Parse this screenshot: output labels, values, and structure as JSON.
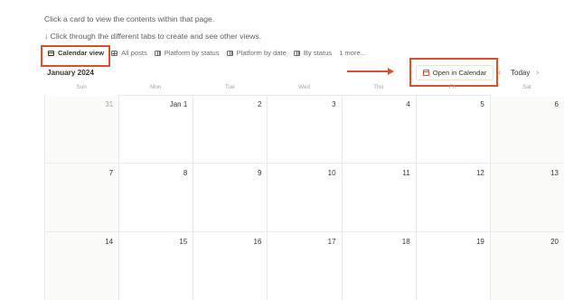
{
  "intro": {
    "line1": "Click a card to view the contents within that page.",
    "line2": "↓ Click through the different tabs to create and see other views."
  },
  "tabs": [
    {
      "label": "Calendar view",
      "icon": "calendar-icon"
    },
    {
      "label": "All posts",
      "icon": "table-icon"
    },
    {
      "label": "Platform by status",
      "icon": "board-icon"
    },
    {
      "label": "Platform by date",
      "icon": "board-icon"
    },
    {
      "label": "By status",
      "icon": "board-icon"
    },
    {
      "label": "1 more...",
      "icon": ""
    }
  ],
  "calendar": {
    "month": "January 2024",
    "open_button": "Open in Calendar",
    "today_label": "Today",
    "prev_icon": "‹",
    "next_icon": "›",
    "weekdays": [
      "Sun",
      "Mon",
      "Tue",
      "Wed",
      "Thu",
      "Fri",
      "Sat"
    ],
    "weeks": [
      [
        "31",
        "Jan 1",
        "2",
        "3",
        "4",
        "5",
        "6"
      ],
      [
        "7",
        "8",
        "9",
        "10",
        "11",
        "12",
        "13"
      ],
      [
        "14",
        "15",
        "16",
        "17",
        "18",
        "19",
        "20"
      ]
    ]
  },
  "colors": {
    "highlight": "#d9512c",
    "weekend_bg": "#fbfbfa"
  }
}
